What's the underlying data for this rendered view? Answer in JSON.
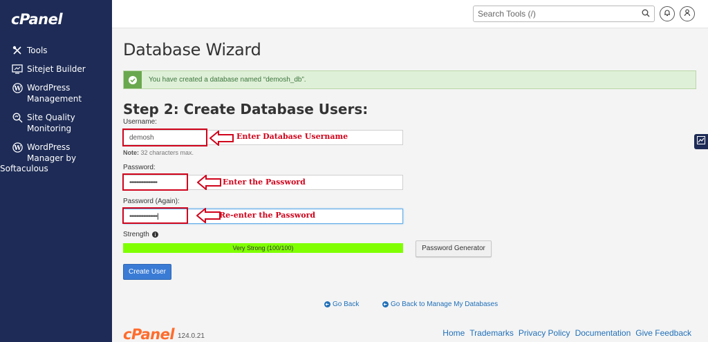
{
  "brand": {
    "logo": "cPanel"
  },
  "sidebar": {
    "items": [
      {
        "label": "Tools",
        "icon": "tools-icon"
      },
      {
        "label": "Sitejet Builder",
        "icon": "sitejet-icon"
      },
      {
        "label": "WordPress",
        "label2": "Management",
        "icon": "wordpress-icon"
      },
      {
        "label": "Site Quality",
        "label2": "Monitoring",
        "icon": "site-quality-icon"
      },
      {
        "label": "WordPress",
        "label2": "Manager by",
        "label3": "Softaculous",
        "icon": "wordpress-icon"
      }
    ]
  },
  "header": {
    "search_placeholder": "Search Tools (/)"
  },
  "main": {
    "title": "Database Wizard",
    "alert": "You have created a database named “demosh_db”.",
    "step_title": "Step 2: Create Database Users:",
    "username_label": "Username:",
    "username_value": "demosh",
    "note_bold": "Note:",
    "note_text": " 32 characters max.",
    "password_label": "Password:",
    "password_value": "••••••••••••••••",
    "password_again_label": "Password (Again):",
    "password_again_value": "••••••••••••••••",
    "strength_label": "Strength",
    "strength_text": "Very Strong (100/100)",
    "strength_value": 100,
    "password_generator": "Password Generator",
    "create_user": "Create User",
    "go_back": "Go Back",
    "go_back_manage": "Go Back to Manage My Databases"
  },
  "annotations": {
    "username": "Enter Database Username",
    "password": "Enter the Password",
    "password_again": "Re-enter the Password",
    "color": "#d0021b"
  },
  "footer": {
    "logo": "cPanel",
    "version": "124.0.21",
    "links": [
      "Home",
      "Trademarks",
      "Privacy Policy",
      "Documentation",
      "Give Feedback"
    ]
  },
  "colors": {
    "sidebar": "#1d2b56",
    "accent": "#3a7bd5",
    "strength": "#7fff00",
    "success": "#6aa84f",
    "footer_logo": "#ff6c2c"
  }
}
